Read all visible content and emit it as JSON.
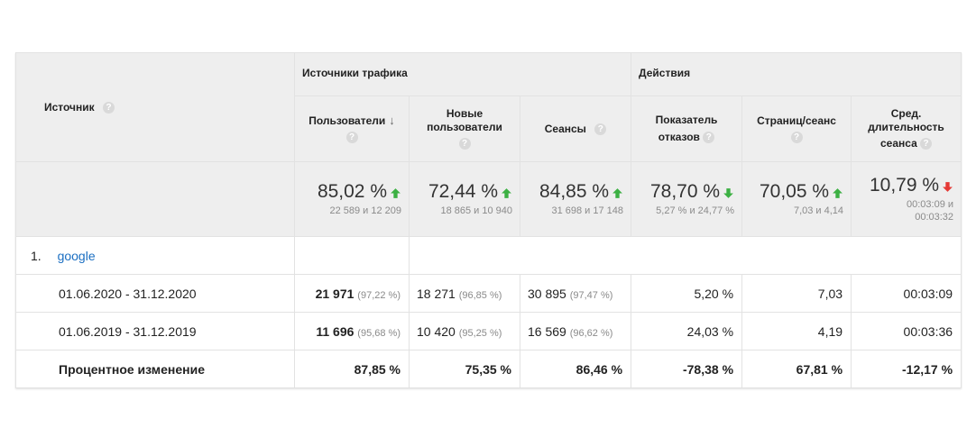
{
  "header": {
    "source_col": "Источник",
    "group_traffic": "Источники трафика",
    "group_actions": "Действия",
    "columns": [
      {
        "l1": "Пользователи",
        "l2": ""
      },
      {
        "l1": "Новые",
        "l2": "пользователи"
      },
      {
        "l1": "Сеансы",
        "l2": ""
      },
      {
        "l1": "Показатель",
        "l2": "отказов"
      },
      {
        "l1": "Страниц/сеанс",
        "l2": ""
      },
      {
        "l1": "Сред.",
        "l2": "длительность",
        "l3": "сеанса"
      }
    ],
    "help_glyph": "?",
    "sort_glyph": "↓"
  },
  "totals": [
    {
      "main": "85,02 %",
      "sub": "22 589 и 12 209",
      "trend": "up"
    },
    {
      "main": "72,44 %",
      "sub": "18 865 и 10 940",
      "trend": "up"
    },
    {
      "main": "84,85 %",
      "sub": "31 698 и 17 148",
      "trend": "up"
    },
    {
      "main": "78,70 %",
      "sub": "5,27 % и 24,77 %",
      "trend": "down-green"
    },
    {
      "main": "70,05 %",
      "sub": "7,03 и 4,14",
      "trend": "up"
    },
    {
      "main": "10,79 %",
      "sub": "00:03:09 и",
      "sub2": "00:03:32",
      "trend": "down-red"
    }
  ],
  "group": {
    "index": "1.",
    "name": "google"
  },
  "rows": [
    {
      "label": "01.06.2020 - 31.12.2020",
      "c1": "21 971",
      "c1p": "(97,22 %)",
      "c2": "18 271",
      "c2p": "(96,85 %)",
      "c3": "30 895",
      "c3p": "(97,47 %)",
      "c4": "5,20 %",
      "c5": "7,03",
      "c6": "00:03:09"
    },
    {
      "label": "01.06.2019 - 31.12.2019",
      "c1": "11 696",
      "c1p": "(95,68 %)",
      "c2": "10 420",
      "c2p": "(95,25 %)",
      "c3": "16 569",
      "c3p": "(96,62 %)",
      "c4": "24,03 %",
      "c5": "4,19",
      "c6": "00:03:36"
    }
  ],
  "change": {
    "label": "Процентное изменение",
    "values": [
      "87,85 %",
      "75,35 %",
      "86,46 %",
      "-78,38 %",
      "67,81 %",
      "-12,17 %"
    ]
  },
  "colors": {
    "up_green": "#3cb043",
    "down_red": "#e53935",
    "link_blue": "#1b6fc2",
    "header_bg": "#eeeeee"
  }
}
